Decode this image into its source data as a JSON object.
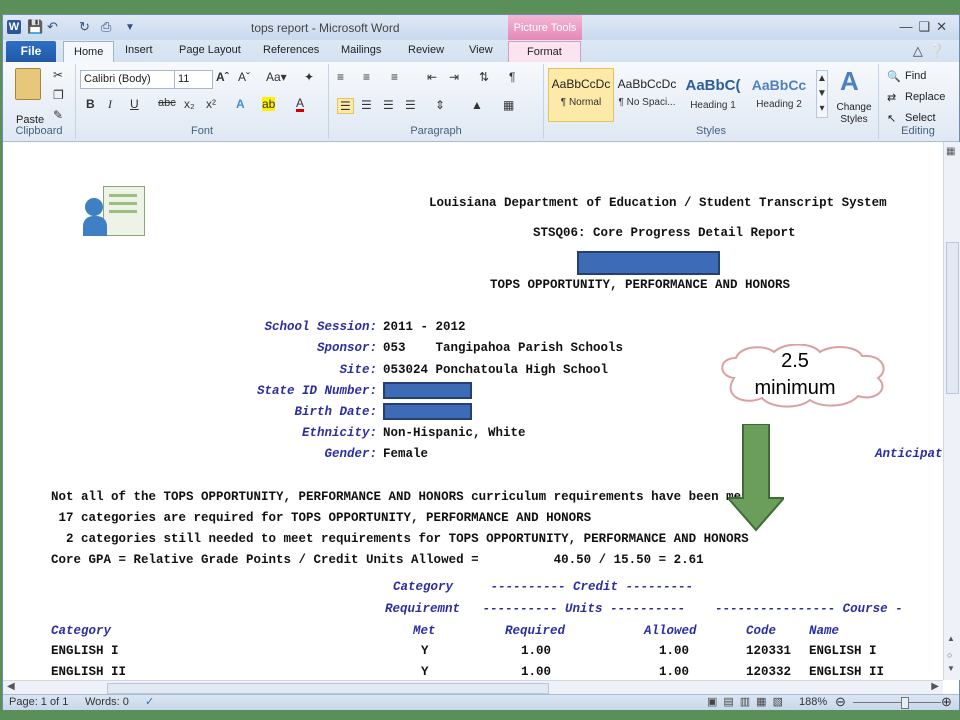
{
  "window": {
    "title": "tops report - Microsoft Word",
    "context_tab_group": "Picture Tools"
  },
  "tabs": {
    "file": "File",
    "items": [
      "Home",
      "Insert",
      "Page Layout",
      "References",
      "Mailings",
      "Review",
      "View",
      "Format"
    ]
  },
  "ribbon": {
    "clipboard": {
      "paste": "Paste",
      "label": "Clipboard"
    },
    "font": {
      "family": "Calibri (Body)",
      "size": "11",
      "label": "Font"
    },
    "paragraph": {
      "label": "Paragraph"
    },
    "styles": {
      "label": "Styles",
      "items": [
        {
          "sample": "AaBbCcDc",
          "name": "¶ Normal"
        },
        {
          "sample": "AaBbCcDc",
          "name": "¶ No Spaci..."
        },
        {
          "sample": "AaBbC(",
          "name": "Heading 1"
        },
        {
          "sample": "AaBbCc",
          "name": "Heading 2"
        }
      ],
      "change_styles": "Change Styles"
    },
    "editing": {
      "find": "Find",
      "replace": "Replace",
      "select": "Select",
      "label": "Editing"
    }
  },
  "document": {
    "header_line1": "Louisiana Department of Education / Student Transcript System",
    "header_line2": "STSQ06: Core Progress Detail Report",
    "header_line3": "TOPS OPPORTUNITY, PERFORMANCE AND HONORS",
    "fields": [
      {
        "label": "School Session:",
        "value": "2011 - 2012"
      },
      {
        "label": "Sponsor:",
        "value": "053    Tangipahoa Parish Schools"
      },
      {
        "label": "Site:",
        "value": "053024 Ponchatoula High School"
      },
      {
        "label": "State ID Number:",
        "value": ""
      },
      {
        "label": "Birth Date:",
        "value": ""
      },
      {
        "label": "Ethnicity:",
        "value": "Non-Hispanic, White"
      },
      {
        "label": "Gender:",
        "value": "Female"
      }
    ],
    "anticipated_label": "Anticipat",
    "summary": [
      "Not all of the TOPS OPPORTUNITY, PERFORMANCE AND HONORS curriculum requirements have been met",
      " 17 categories are required for TOPS OPPORTUNITY, PERFORMANCE AND HONORS",
      "  2 categories still needed to meet requirements for TOPS OPPORTUNITY, PERFORMANCE AND HONORS",
      "Core GPA = Relative Grade Points / Credit Units Allowed =          40.50 / 15.50 = 2.61"
    ],
    "table_header": {
      "top1": "Category     ---------- Credit ---------",
      "top2": "Requiremnt   ---------- Units ----------    ---------------- Course -",
      "cols": [
        "Category",
        "Met",
        "Required",
        "Allowed",
        "Code",
        "Name"
      ]
    },
    "rows": [
      {
        "category": "ENGLISH I",
        "met": "Y",
        "required": "1.00",
        "allowed": "1.00",
        "code": "120331",
        "name": "ENGLISH I"
      },
      {
        "category": "ENGLISH II",
        "met": "Y",
        "required": "1.00",
        "allowed": "1.00",
        "code": "120332",
        "name": "ENGLISH II"
      }
    ]
  },
  "callout": {
    "line1": "2.5",
    "line2": "minimum"
  },
  "status": {
    "page": "Page: 1 of 1",
    "words": "Words: 0",
    "zoom": "188%"
  },
  "colors": {
    "background": "#5a8f5a",
    "redaction": "#3e6bb5",
    "label_blue": "#2a2ea3",
    "arrow": "#6b9e5a"
  }
}
